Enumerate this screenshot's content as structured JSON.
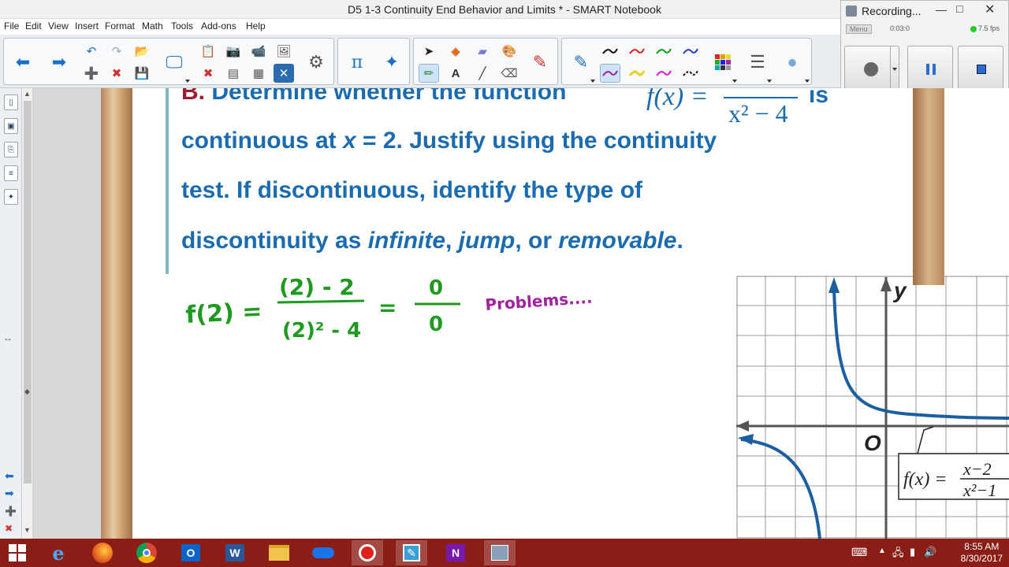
{
  "window": {
    "title": "D5 1-3 Continuity End Behavior and Limits * - SMART Notebook"
  },
  "menu": [
    "File",
    "Edit",
    "View",
    "Insert",
    "Format",
    "Math",
    "Tools",
    "Add-ons",
    "Help"
  ],
  "recorder": {
    "title": "Recording...",
    "menu_label": "Menu",
    "time": "0:03:0",
    "fps": "7.5 fps"
  },
  "slide": {
    "q_letter": "B.",
    "line1": "Determine whether the function",
    "fx_num": "f(x) =",
    "fx_den": "x² − 4",
    "line1_end": "is",
    "line2a": "continuous at ",
    "line2_x": "x",
    "line2b": " = 2. Justify using the continuity",
    "line3": "test. If discontinuous, identify the type of",
    "line4a": "discontinuity as ",
    "line4_inf": "infinite",
    "line4_c1": ", ",
    "line4_jump": "jump",
    "line4_c2": ", or ",
    "line4_rem": "removable",
    "line4_end": ".",
    "ink_lhs": "f(2) =",
    "ink_num": "(2) - 2",
    "ink_den": "(2)² - 4",
    "ink_eq": "=",
    "ink_zero_num": "0",
    "ink_zero_den": "0",
    "ink_note": "Problems....",
    "graph": {
      "x_label": "x",
      "y_label": "y",
      "origin_label": "O",
      "callout_lhs": "f(x) =",
      "callout_num": "x−2",
      "callout_den": "x²−1"
    }
  },
  "taskbar": {
    "time": "8:55 AM",
    "date": "8/30/2017"
  },
  "colors": {
    "title_blue": "#1b6bb0",
    "letter_red": "#9e1b32",
    "ink_green": "#1e9a1e",
    "ink_purple": "#a020a0",
    "taskbar": "#8b1d17"
  }
}
